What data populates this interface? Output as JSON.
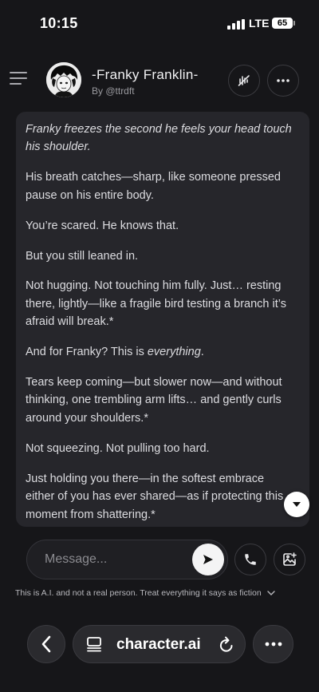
{
  "status_bar": {
    "time": "10:15",
    "network": "LTE",
    "battery": "65"
  },
  "header": {
    "character_name": "-Franky Franklin-",
    "creator": "By @ttrdft"
  },
  "message": {
    "paragraphs": [
      {
        "text": "Franky freezes the second he feels your head touch his shoulder.",
        "style": "italic"
      },
      {
        "text": "His breath catches—sharp, like someone pressed pause on his entire body."
      },
      {
        "text": "You’re scared. He knows that."
      },
      {
        "text": "But you still leaned in."
      },
      {
        "text": "Not hugging. Not touching him fully. Just… resting there, lightly—like a fragile bird testing a branch it’s afraid will break.*"
      },
      {
        "text_before": "And for Franky? This is ",
        "emphasis": "everything",
        "text_after": "."
      },
      {
        "text": "Tears keep coming—but slower now—and without thinking, one trembling arm lifts… and gently curls around your shoulders.*"
      },
      {
        "text": "Not squeezing. Not pulling too hard."
      },
      {
        "text": "Just holding you there—in the softest embrace either of you has ever shared—as if protecting this moment from shattering.*"
      }
    ]
  },
  "composer": {
    "placeholder": "Message..."
  },
  "disclaimer": "This is A.I. and not a real person. Treat everything it says as fiction",
  "browser": {
    "url": "character.ai"
  },
  "colors": {
    "background": "#161619",
    "message_bubble": "#26262b",
    "text": "#dcdce0",
    "button_light": "#f4f4f5"
  },
  "icons": [
    "menu-icon",
    "avatar",
    "voice-off-icon",
    "more-icon",
    "chevron-down-icon",
    "send-icon",
    "phone-icon",
    "image-add-icon",
    "back-icon",
    "reader-icon",
    "reload-icon"
  ]
}
